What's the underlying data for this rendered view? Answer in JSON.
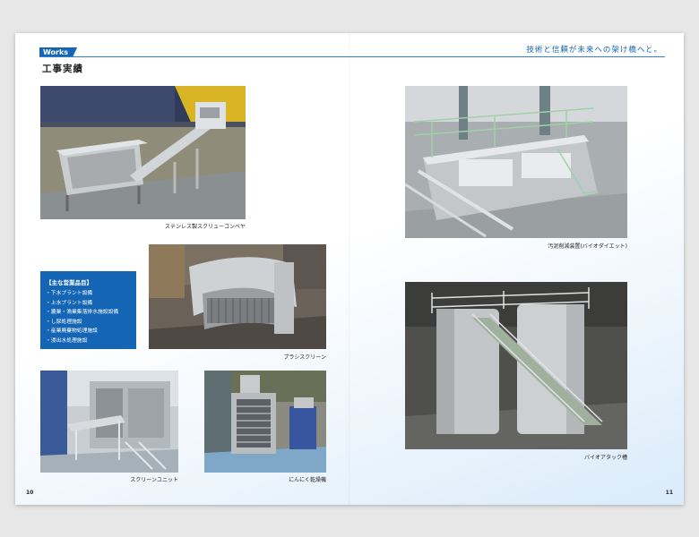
{
  "header": {
    "tag": "Works",
    "slogan": "技術と信頼が未来への架け橋へと。",
    "title": "工事実績"
  },
  "photos": {
    "conveyor": "ステンレス製スクリューコンベヤ",
    "brush_screen": "ブラシスクリーン",
    "screen_unit": "スクリーンユニット",
    "garlic_dryer": "にんにく乾燥機",
    "aeration": "汚泥削減装置(バイオダイエット)",
    "bio_tank": "バイオアタック槽"
  },
  "products": {
    "heading": "【主な営業品目】",
    "items": [
      "・下水プラント設備",
      "・上水プラント設備",
      "・農業・漁業集落排水施設設備",
      "・し尿処理施設",
      "・産業廃棄物処理施設",
      "・浸出水処理施設"
    ]
  },
  "page_numbers": {
    "left": "10",
    "right": "11"
  },
  "colors": {
    "accent": "#1565b5"
  }
}
